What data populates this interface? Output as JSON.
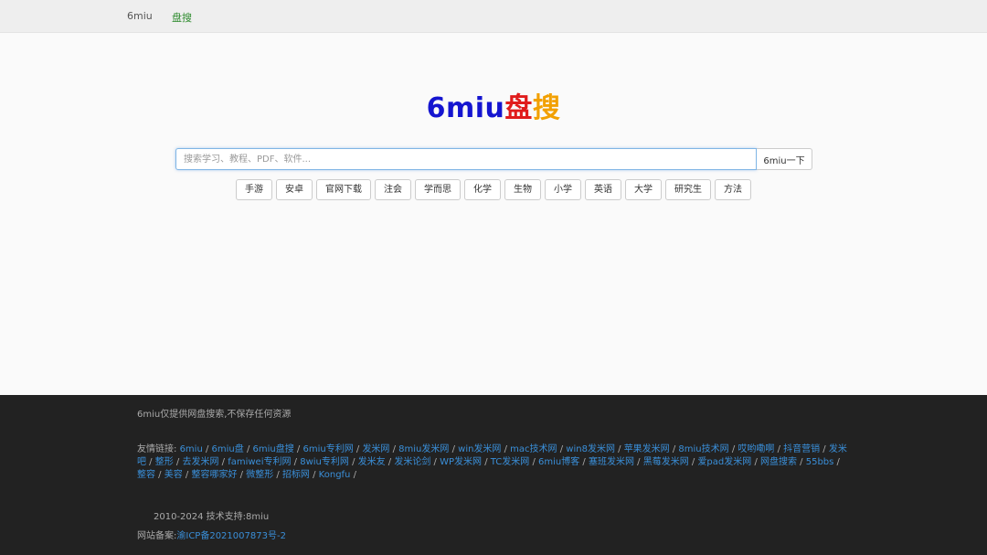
{
  "nav": {
    "home": "6miu",
    "active": "盘搜"
  },
  "logo": {
    "parts": [
      {
        "text": "6miu",
        "color": "#1515d0"
      },
      {
        "text": "盘",
        "color": "#e01c1c"
      },
      {
        "text": "搜",
        "color": "#f2a000"
      }
    ]
  },
  "search": {
    "placeholder": "搜索学习、教程、PDF、软件...",
    "value": "",
    "button_label": "6miu一下"
  },
  "tags": [
    "手游",
    "安卓",
    "官网下载",
    "注会",
    "学而思",
    "化学",
    "生物",
    "小学",
    "英语",
    "大学",
    "研究生",
    "方法"
  ],
  "footer": {
    "disclaimer": "6miu仅提供网盘搜索,不保存任何资源",
    "links_label": "友情链接:",
    "links": [
      "6miu",
      "6miu盘",
      "6miu盘搜",
      "6miu专利网",
      "发米网",
      "8miu发米网",
      "win发米网",
      "mac技术网",
      "win8发米网",
      "苹果发米网",
      "8miu技术网",
      "哎哟嘞啊",
      "抖音营销",
      "发米吧",
      "整形",
      "去发米网",
      "famiwei专利网",
      "8wiu专利网",
      "发米友",
      "发米论剑",
      "WP发米网",
      "TC发米网",
      "6miu博客",
      "塞班发米网",
      "黑莓发米网",
      "爱pad发米网",
      "网盘搜索",
      "55bbs",
      "整容",
      "美容",
      "整容哪家好",
      "微整形",
      "招标网",
      "Kongfu"
    ],
    "copyright": "2010-2024 技术支持:8miu",
    "icp_label": "网站备案:",
    "icp_number": "渝ICP备2021007873号-2"
  }
}
